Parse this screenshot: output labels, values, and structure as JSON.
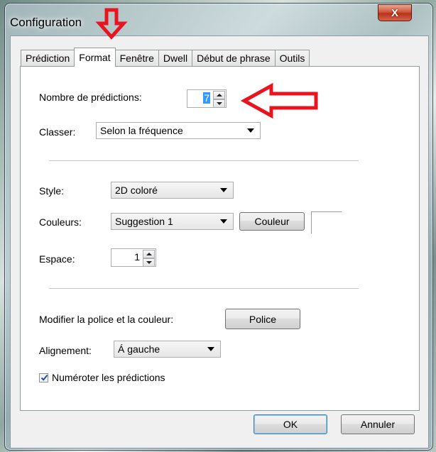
{
  "window": {
    "title": "Configuration",
    "close_label": "X"
  },
  "tabs": [
    {
      "label": "Prédiction",
      "active": false
    },
    {
      "label": "Format",
      "active": true
    },
    {
      "label": "Fenêtre",
      "active": false
    },
    {
      "label": "Dwell",
      "active": false
    },
    {
      "label": "Début de phrase",
      "active": false
    },
    {
      "label": "Outils",
      "active": false
    }
  ],
  "predictions": {
    "label": "Nombre de prédictions:",
    "value": "7"
  },
  "sort": {
    "label": "Classer:",
    "value": "Selon la fréquence"
  },
  "style": {
    "label": "Style:",
    "value": "2D coloré"
  },
  "colors": {
    "label": "Couleurs:",
    "value": "Suggestion 1",
    "button_label": "Couleur"
  },
  "spacing": {
    "label": "Espace:",
    "value": "1"
  },
  "font": {
    "label": "Modifier la police et la couleur:",
    "button_label": "Police"
  },
  "alignment": {
    "label": "Alignement:",
    "value": "Á gauche"
  },
  "numbering": {
    "label": "Numéroter les prédictions",
    "checked": true
  },
  "footer": {
    "ok_label": "OK",
    "cancel_label": "Annuler"
  },
  "annotation_color": "#e8141e"
}
